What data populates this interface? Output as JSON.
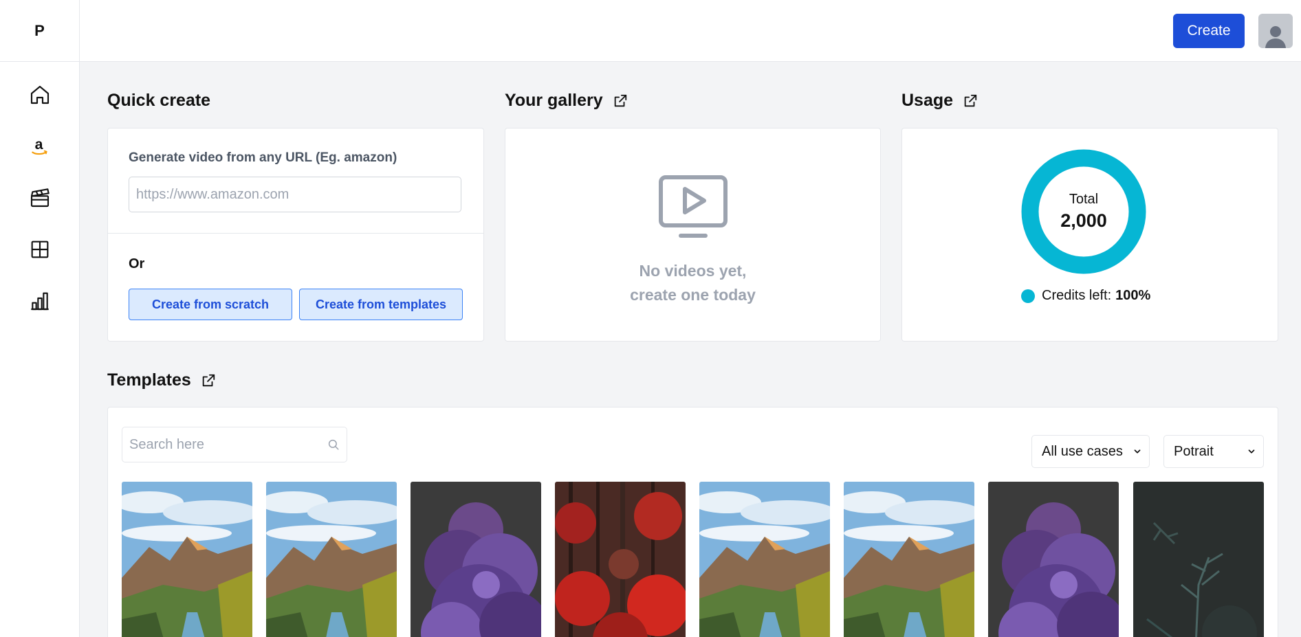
{
  "app": {
    "logo": "P"
  },
  "sidebar": {
    "items": [
      {
        "name": "home",
        "icon": "home-icon"
      },
      {
        "name": "amazon",
        "icon": "amazon-icon"
      },
      {
        "name": "videos",
        "icon": "clapperboard-icon"
      },
      {
        "name": "templates",
        "icon": "grid-icon"
      },
      {
        "name": "analytics",
        "icon": "bar-chart-icon"
      }
    ]
  },
  "topbar": {
    "create_label": "Create"
  },
  "quick_create": {
    "title": "Quick create",
    "url_label": "Generate video from any URL (Eg. amazon)",
    "url_placeholder": "https://www.amazon.com",
    "or_label": "Or",
    "scratch_label": "Create from scratch",
    "templates_label": "Create from templates"
  },
  "gallery": {
    "title": "Your gallery",
    "empty_line1": "No videos yet,",
    "empty_line2": "create one today"
  },
  "usage": {
    "title": "Usage",
    "total_label": "Total",
    "total_value": "2,000",
    "credits_label": "Credits left:",
    "credits_value": "100%",
    "credits_fraction": 1.0,
    "accent_color": "#06b6d4"
  },
  "templates": {
    "title": "Templates",
    "search_placeholder": "Search here",
    "use_case_selected": "All use cases",
    "orientation_selected": "Potrait",
    "thumbnails": [
      {
        "kind": "mountain-river"
      },
      {
        "kind": "mountain-river"
      },
      {
        "kind": "purple-flowers"
      },
      {
        "kind": "red-forest"
      },
      {
        "kind": "mountain-river"
      },
      {
        "kind": "mountain-river"
      },
      {
        "kind": "purple-flowers"
      },
      {
        "kind": "dark-fern"
      }
    ]
  },
  "colors": {
    "primary": "#1d4ed8",
    "background": "#f3f4f6"
  }
}
